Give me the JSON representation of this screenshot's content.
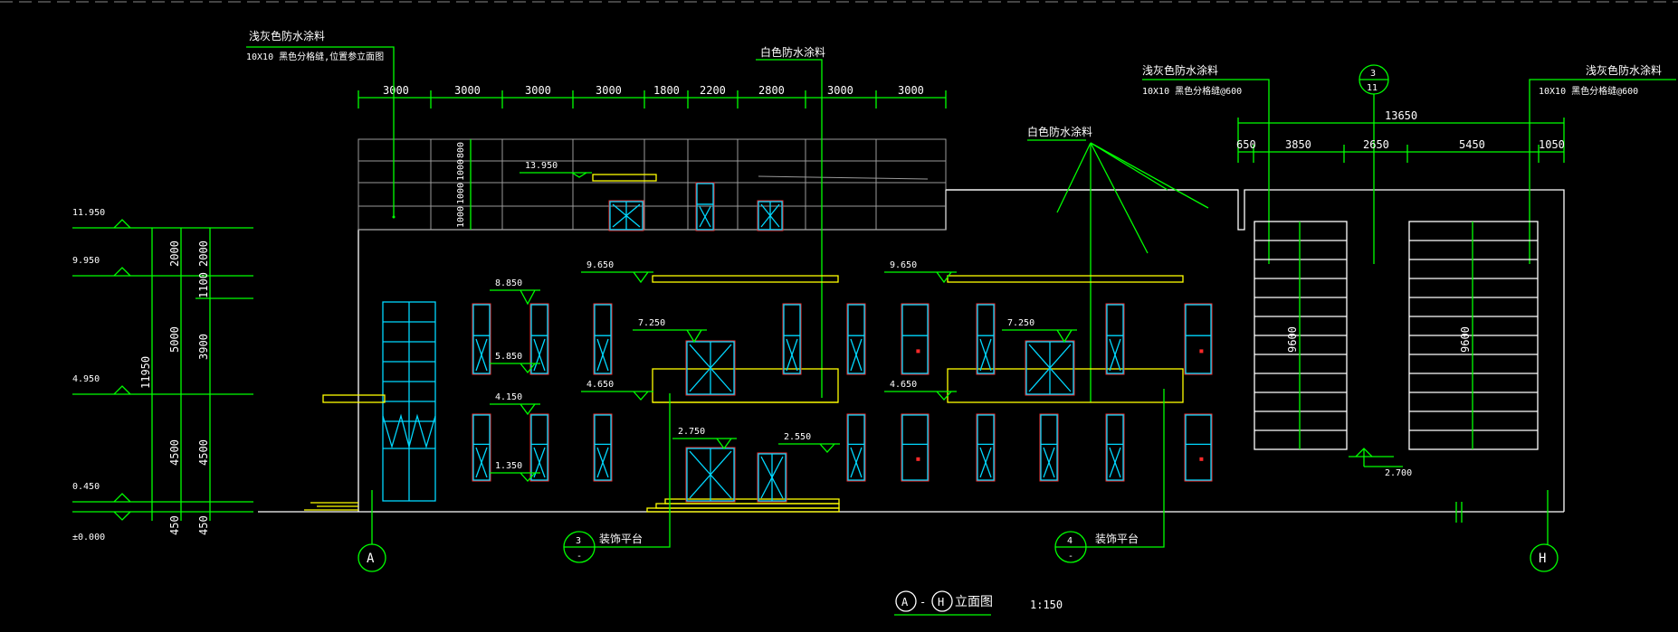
{
  "drawing": {
    "title": "立面图",
    "title_axis_start": "A",
    "title_axis_end": "H",
    "title_dash": "-",
    "scale": "1:150"
  },
  "notes": {
    "note1_line1": "浅灰色防水涂料",
    "note1_line2": "10X10  黑色分格缝,位置参立面图",
    "note2": "白色防水涂料",
    "note3_line1": "浅灰色防水涂料",
    "note3_line2": "10X10  黑色分格缝@600",
    "note4": "白色防水涂料",
    "note5_line1": "浅灰色防水涂料",
    "note5_line2": "10X10  黑色分格缝@600"
  },
  "top_dimensions": [
    "3000",
    "3000",
    "3000",
    "3000",
    "1800",
    "2200",
    "2800",
    "3000",
    "3000"
  ],
  "right_dimension_total": "13650",
  "right_dimensions": [
    "650",
    "3850",
    "2650",
    "5450",
    "1050"
  ],
  "left_levels": [
    "11.950",
    "9.950",
    "4.950",
    "0.450",
    "±0.000"
  ],
  "left_dims_outer": [
    "2000",
    "5000",
    "4500",
    "450"
  ],
  "left_dims_inner": [
    "2000",
    "1100",
    "3900",
    "4500",
    "450"
  ],
  "left_dim_total": "11950",
  "parapet_dims": [
    "800",
    "1000",
    "1000",
    "1000"
  ],
  "level_marks": {
    "roof_13950": "13.950",
    "l_9650_a": "9.650",
    "l_9650_b": "9.650",
    "l_8850": "8.850",
    "l_7250_a": "7.250",
    "l_7250_b": "7.250",
    "l_5850": "5.850",
    "l_4650_a": "4.650",
    "l_4650_b": "4.650",
    "l_4150": "4.150",
    "l_2750": "2.750",
    "l_2550": "2.550",
    "l_1350": "1.350",
    "l_2700": "2.700"
  },
  "vertical_dims": [
    "9600",
    "9600"
  ],
  "axes": {
    "left": "A",
    "right": "H"
  },
  "detail_callouts": [
    {
      "num": "3",
      "sheet": "-",
      "label": "装饰平台"
    },
    {
      "num": "4",
      "sheet": "-",
      "label": "装饰平台"
    },
    {
      "num": "3",
      "sheet": "11",
      "label": ""
    }
  ]
}
